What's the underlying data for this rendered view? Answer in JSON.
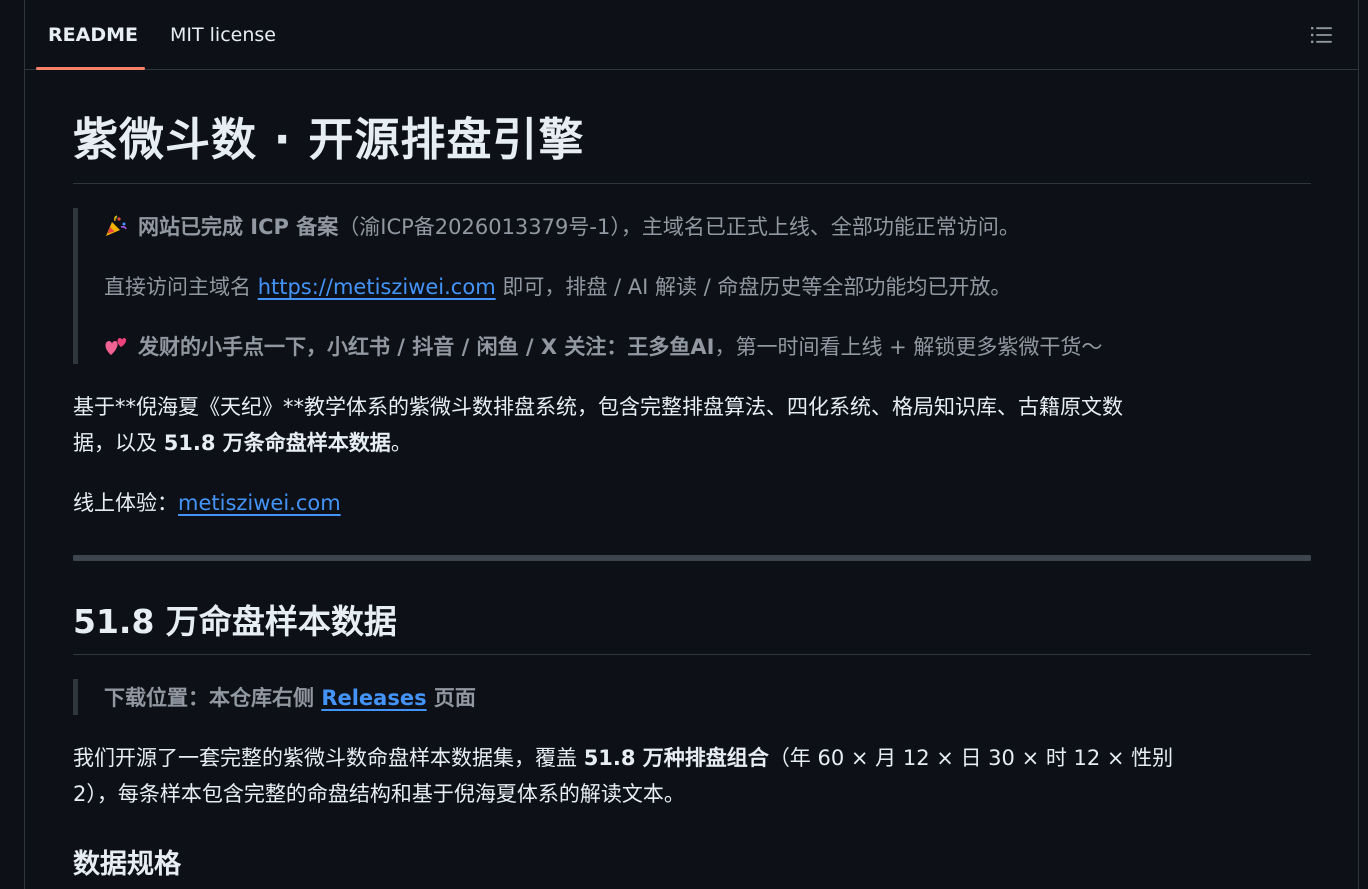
{
  "tabs": {
    "readme": "README",
    "license": "MIT license"
  },
  "title": "紫微斗数 · 开源排盘引擎",
  "notice": {
    "line1_bold": "网站已完成 ICP 备案",
    "line1_rest": "（渝ICP备2026013379号-1），主域名已正式上线、全部功能正常访问。",
    "line2_pre": "直接访问主域名 ",
    "line2_link": "https://metisziwei.com",
    "line2_post": " 即可，排盘 / AI 解读 / 命盘历史等全部功能均已开放。",
    "line3_bold": "发财的小手点一下，小红书 / 抖音 / 闲鱼 / X 关注：王多鱼AI",
    "line3_rest": "，第一时间看上线 + 解锁更多紫微干货～",
    "party_icon": "party-popper-icon",
    "hearts_icon": "two-hearts-icon"
  },
  "intro": {
    "line1": "基于**倪海夏《天纪》**教学体系的紫微斗数排盘系统，包含完整排盘算法、四化系统、格局知识库、古籍原文数",
    "line2_pre": "据，以及 ",
    "line2_bold": "51.8 万条命盘样本数据",
    "line2_post": "。"
  },
  "online": {
    "label": "线上体验：",
    "link": "metisziwei.com"
  },
  "section": {
    "title": "51.8 万命盘样本数据",
    "download_pre": "下载位置：本仓库右侧 ",
    "download_link": "Releases",
    "download_post": " 页面",
    "desc1_pre": "我们开源了一套完整的紫微斗数命盘样本数据集，覆盖 ",
    "desc1_bold": "51.8 万种排盘组合",
    "desc1_post": "（年 60 × 月 12 × 日 30 × 时 12 × 性别",
    "desc2": "2），每条样本包含完整的命盘结构和基于倪海夏体系的解读文本。"
  },
  "subsection": {
    "title": "数据规格"
  }
}
